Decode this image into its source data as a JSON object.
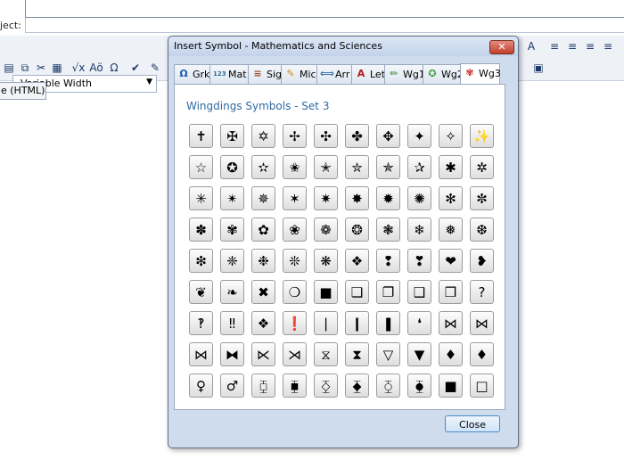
{
  "background": {
    "subject_label": "ject:",
    "font_select_value": "Variable Width",
    "html_tab_label": "e (HTML)",
    "toolbar_icons": [
      "paste-icon",
      "copy-icon",
      "cut-icon",
      "table-icon",
      "sqrt-icon",
      "spell-icon",
      "omega-icon",
      "check-icon",
      "brush-icon"
    ],
    "toolbar_glyphs": [
      "▤",
      "⧉",
      "✂",
      "▦",
      "√x",
      "Aö",
      "Ω",
      "✔",
      "✎"
    ],
    "right_toolbar_glyphs": [
      "A",
      "≡",
      "≡",
      "≡",
      "≡",
      "▣"
    ]
  },
  "dialog": {
    "title": "Insert Symbol - Mathematics and Sciences",
    "close_x": "✕",
    "tabs": [
      {
        "label": "Grk",
        "icon": "Ω",
        "icon_name": "omega-icon",
        "color": "#1a5ea8"
      },
      {
        "label": "Mat",
        "icon": "123",
        "icon_name": "number-icon",
        "color": "#2e6aa0"
      },
      {
        "label": "Sig",
        "icon": "≡",
        "icon_name": "sigma-icon",
        "color": "#a0502e"
      },
      {
        "label": "Mic",
        "icon": "✎",
        "icon_name": "pencil-icon",
        "color": "#c98a1a"
      },
      {
        "label": "Arr",
        "icon": "⟺",
        "icon_name": "arrow-icon",
        "color": "#2e6aa0"
      },
      {
        "label": "Let",
        "icon": "A",
        "icon_name": "letter-icon",
        "color": "#b01c1c"
      },
      {
        "label": "Wg1",
        "icon": "✏",
        "icon_name": "wingdings-1-icon",
        "color": "#2e7d32"
      },
      {
        "label": "Wg2",
        "icon": "✪",
        "icon_name": "wingdings-2-icon",
        "color": "#43a047"
      },
      {
        "label": "Wg3",
        "icon": "✾",
        "icon_name": "wingdings-3-icon",
        "color": "#c62828"
      }
    ],
    "active_tab": "Wg3",
    "set_heading": "Wingdings Symbols - Set 3",
    "symbols": [
      [
        "✝",
        "✠",
        "✡",
        "✢",
        "✣",
        "✤",
        "✥",
        "✦",
        "✧",
        "✨"
      ],
      [
        "☆",
        "✪",
        "✫",
        "✬",
        "✭",
        "✮",
        "✯",
        "✰",
        "✱",
        "✲"
      ],
      [
        "✳",
        "✴",
        "✵",
        "✶",
        "✷",
        "✸",
        "✹",
        "✺",
        "✻",
        "✼"
      ],
      [
        "✽",
        "✾",
        "✿",
        "❀",
        "❁",
        "❂",
        "❃",
        "❄",
        "❅",
        "❆"
      ],
      [
        "❇",
        "❈",
        "❉",
        "❊",
        "❋",
        "❖",
        "❢",
        "❣",
        "❤",
        "❥"
      ],
      [
        "❦",
        "❧",
        "✖",
        "❍",
        "■",
        "❏",
        "❐",
        "❑",
        "❒",
        "?"
      ],
      [
        "‽",
        "‼",
        "❖",
        "❗",
        "❘",
        "❙",
        "❚",
        "❛",
        "⋈",
        "⋈"
      ],
      [
        "⋈",
        "⧓",
        "⋉",
        "⋊",
        "⧖",
        "⧗",
        "▽",
        "▼",
        "♦",
        "♦"
      ],
      [
        "♀",
        "♂",
        "⧮",
        "⧯",
        "⧰",
        "⧱",
        "⧲",
        "⧳",
        "■",
        "□"
      ]
    ],
    "close_button_label": "Close"
  }
}
